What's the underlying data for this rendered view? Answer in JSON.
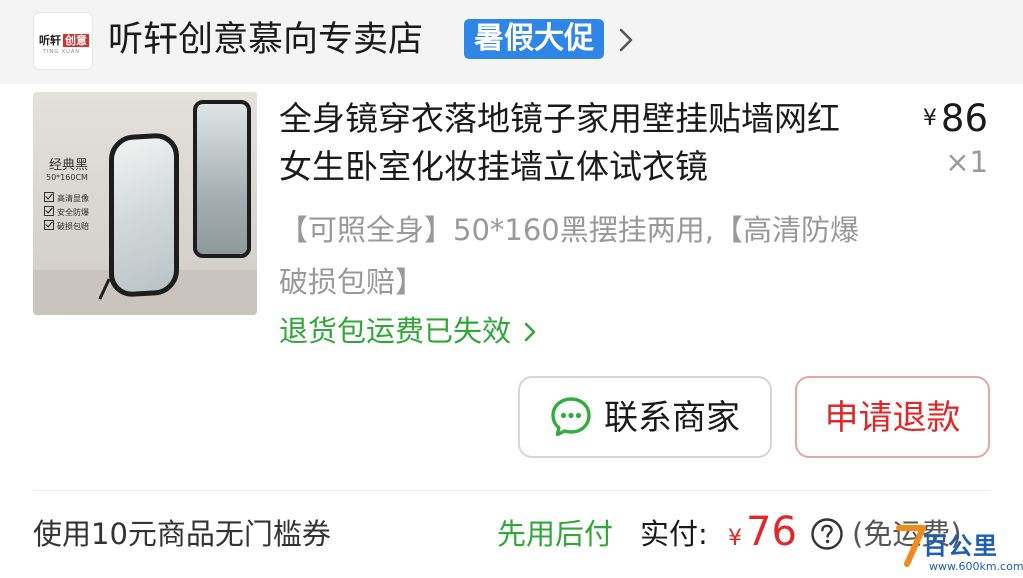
{
  "store": {
    "logo_text_a": "听轩",
    "logo_text_b": "创意",
    "logo_sub": "TING XUAN",
    "name": "听轩创意慕向专卖店",
    "promo_badge": "暑假大促"
  },
  "product": {
    "image": {
      "title": "经典黑",
      "size": "50*160CM",
      "features": [
        "高清显像",
        "安全防爆",
        "破损包赔"
      ]
    },
    "title": "全身镜穿衣落地镜子家用壁挂贴墙网红女生卧室化妆挂墙立体试衣镜",
    "sku": "【可照全身】50*160黑摆挂两用,【高清防爆 破损包赔】",
    "price_symbol": "¥",
    "price": "86",
    "quantity": "×1",
    "return_notice": "退货包运费已失效"
  },
  "actions": {
    "contact_label": "联系商家",
    "refund_label": "申请退款"
  },
  "footer": {
    "coupon_text": "使用10元商品无门槛券",
    "pay_later": "先用后付",
    "actual_label": "实付:",
    "actual_symbol": "¥",
    "actual_amount": "76",
    "shipping_note": "(免运费)"
  },
  "watermark": {
    "text": "百公里",
    "url": "www.600km.com"
  },
  "colors": {
    "accent_green": "#30a838",
    "refund_red": "#e02828",
    "promo_blue": "#2f86e6"
  }
}
